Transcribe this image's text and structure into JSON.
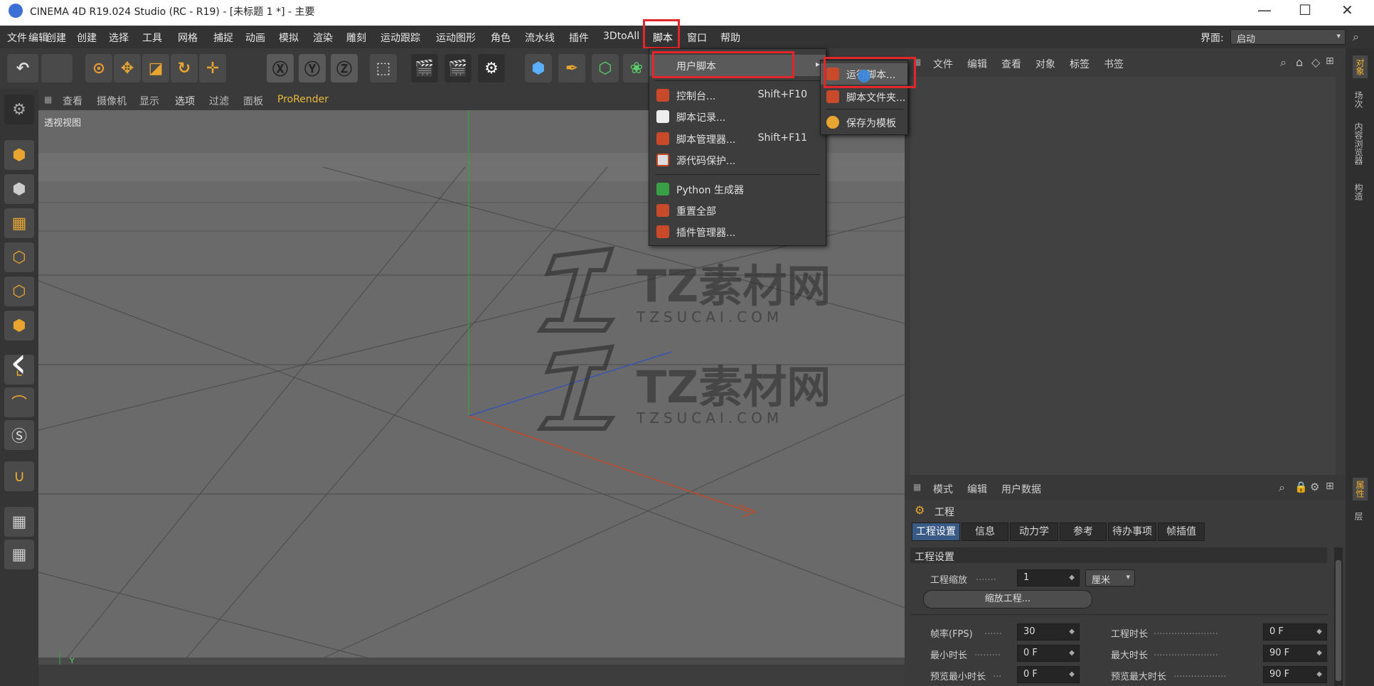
{
  "titlebar": {
    "title": "CINEMA 4D R19.024 Studio (RC - R19) - [未标题 1 *] - 主要",
    "minimize_glyph": "—",
    "maximize_glyph": "☐",
    "close_glyph": "✕"
  },
  "menubar": {
    "items": [
      "文件",
      "编辑",
      "创建",
      "选择",
      "工具",
      "网格",
      "捕捉",
      "动画",
      "模拟",
      "渲染",
      "雕刻",
      "运动跟踪",
      "运动图形",
      "角色",
      "流水线",
      "插件",
      "3DtoAll",
      "脚本",
      "窗口",
      "帮助"
    ],
    "layout_label": "界面:",
    "layout_value": "启动"
  },
  "viewport": {
    "menu": [
      "查看",
      "摄像机",
      "显示",
      "选项",
      "过滤",
      "面板",
      "ProRender"
    ],
    "label": "透视视图",
    "axis_y_label": "Y"
  },
  "script_menu": {
    "items": [
      {
        "label": "用户脚本",
        "shortcut": "",
        "has_submenu": true
      },
      {
        "label": "控制台...",
        "shortcut": "Shift+F10"
      },
      {
        "label": "脚本记录...",
        "shortcut": ""
      },
      {
        "label": "脚本管理器...",
        "shortcut": "Shift+F11"
      },
      {
        "label": "源代码保护...",
        "shortcut": ""
      },
      {
        "label": "Python 生成器",
        "shortcut": ""
      },
      {
        "label": "重置全部",
        "shortcut": ""
      },
      {
        "label": "插件管理器...",
        "shortcut": ""
      }
    ],
    "submenu": [
      "运行脚本...",
      "脚本文件夹...",
      "保存为模板"
    ],
    "submenu_arrow": "▸"
  },
  "object_manager": {
    "menu": [
      "文件",
      "编辑",
      "查看",
      "对象",
      "标签",
      "书签"
    ]
  },
  "attribute_manager": {
    "menu": [
      "模式",
      "编辑",
      "用户数据"
    ],
    "title": "工程",
    "tabs": [
      "工程设置",
      "信息",
      "动力学",
      "参考",
      "待办事项",
      "帧插值"
    ],
    "section_title": "工程设置",
    "fields": {
      "scale_label": "工程缩放",
      "scale_value": "1",
      "scale_unit": "厘米",
      "scale_button": "缩放工程...",
      "fps_label": "帧率(FPS)",
      "fps_value": "30",
      "duration_label": "工程时长",
      "duration_value": "0 F",
      "min_time_label": "最小时长",
      "min_time_value": "0 F",
      "max_time_label": "最大时长",
      "max_time_value": "90 F",
      "preview_min_label": "预览最小时长",
      "preview_min_value": "0 F",
      "preview_max_label": "预览最大时长",
      "preview_max_value": "90 F"
    }
  },
  "side_tabs_top": [
    "对象",
    "场次",
    "内容浏览器",
    "构造"
  ],
  "side_tabs_bottom": [
    "属性",
    "层"
  ],
  "watermark": {
    "text": "TZ素材网",
    "url": "TZSUCAI.COM"
  },
  "colors": {
    "highlight_red": "#e3262b",
    "accent_blue": "#3a5a86",
    "menu_hover": "#5a5a5a"
  }
}
